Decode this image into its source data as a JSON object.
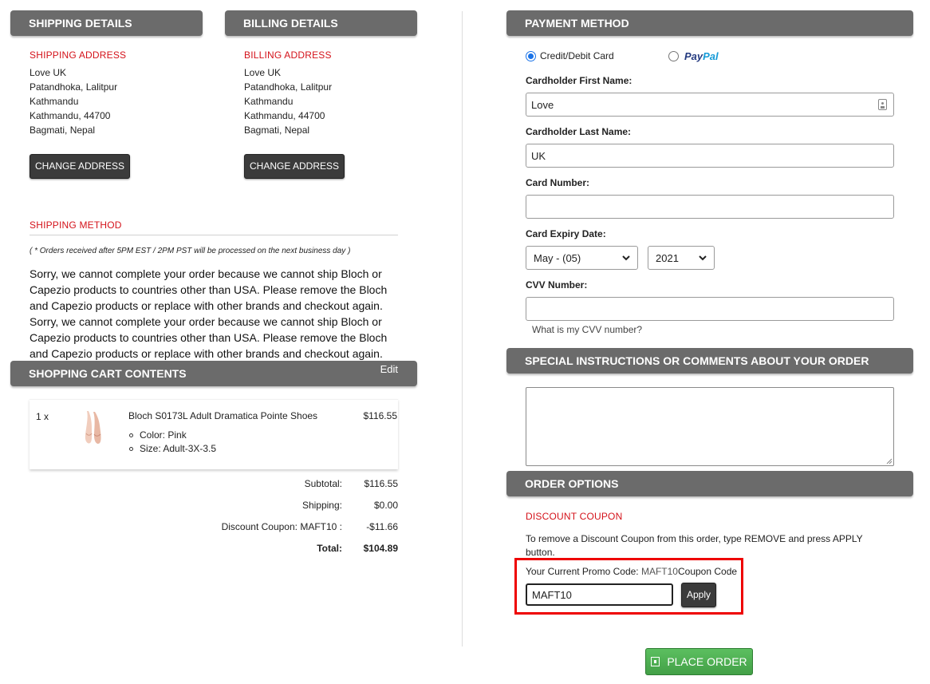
{
  "shipping_details": {
    "header": "SHIPPING DETAILS",
    "address_title": "SHIPPING ADDRESS",
    "address_lines": [
      "Love UK",
      "Patandhoka, Lalitpur",
      "Kathmandu",
      "Kathmandu, 44700",
      "Bagmati, Nepal"
    ],
    "change_label": "CHANGE ADDRESS"
  },
  "billing_details": {
    "header": "BILLING DETAILS",
    "address_title": "BILLING ADDRESS",
    "address_lines": [
      "Love UK",
      "Patandhoka, Lalitpur",
      "Kathmandu",
      "Kathmandu, 44700",
      "Bagmati, Nepal"
    ],
    "change_label": "CHANGE ADDRESS"
  },
  "shipping_method": {
    "title": "SHIPPING METHOD",
    "note": "( * Orders received after 5PM EST / 2PM PST will be processed on the next business day )",
    "message_lines": [
      "Sorry, we cannot complete your order because we cannot ship Bloch or",
      "Capezio products to countries other than USA. Please remove the Bloch",
      "and Capezio products or replace with other brands and checkout again.",
      "Sorry, we cannot complete your order because we cannot ship Bloch or",
      "Capezio products to countries other than USA. Please remove the Bloch",
      "and Capezio products or replace with other brands and checkout again."
    ]
  },
  "cart": {
    "header": "SHOPPING CART CONTENTS",
    "edit_label": "Edit",
    "item": {
      "qty": "1 x",
      "name": "Bloch S0173L Adult Dramatica Pointe Shoes",
      "attributes": [
        "Color: Pink",
        "Size: Adult-3X-3.5"
      ],
      "price": "$116.55"
    },
    "totals": [
      {
        "label": "Subtotal:",
        "value": "$116.55"
      },
      {
        "label": "Shipping:",
        "value": "$0.00"
      },
      {
        "label": "Discount Coupon: MAFT10 :",
        "value": "-$11.66"
      },
      {
        "label": "Total:",
        "value": "$104.89"
      }
    ]
  },
  "payment": {
    "header": "PAYMENT METHOD",
    "option_card": "Credit/Debit Card",
    "option_paypal_pay": "Pay",
    "option_paypal_pal": "Pal",
    "first_name_label": "Cardholder First Name:",
    "first_name_value": "Love",
    "last_name_label": "Cardholder Last Name:",
    "last_name_value": "UK",
    "card_number_label": "Card Number:",
    "card_number_value": "",
    "expiry_label": "Card Expiry Date:",
    "expiry_month": "May - (05)",
    "expiry_year": "2021",
    "cvv_label": "CVV Number:",
    "cvv_value": "",
    "cvv_help": "What is my CVV number?"
  },
  "instructions": {
    "header": "SPECIAL INSTRUCTIONS OR COMMENTS ABOUT YOUR ORDER",
    "value": ""
  },
  "order_options": {
    "header": "ORDER OPTIONS",
    "coupon_title": "DISCOUNT COUPON",
    "remove_text_1": "To remove a Discount Coupon from this order, type REMOVE and press APPLY",
    "remove_text_2": "button.",
    "promo_label": "Your Current Promo Code: ",
    "promo_code": "MAFT10",
    "promo_suffix": "Coupon Code",
    "coupon_value": "MAFT10",
    "apply_label": "Apply",
    "place_order_label": "PLACE ORDER"
  },
  "colors": {
    "header_bg": "#6b6b6b",
    "accent_red": "#d4121a",
    "button_dark": "#3b3b3b",
    "place_order_green": "#4caf50",
    "highlight_red": "#ee0000"
  }
}
